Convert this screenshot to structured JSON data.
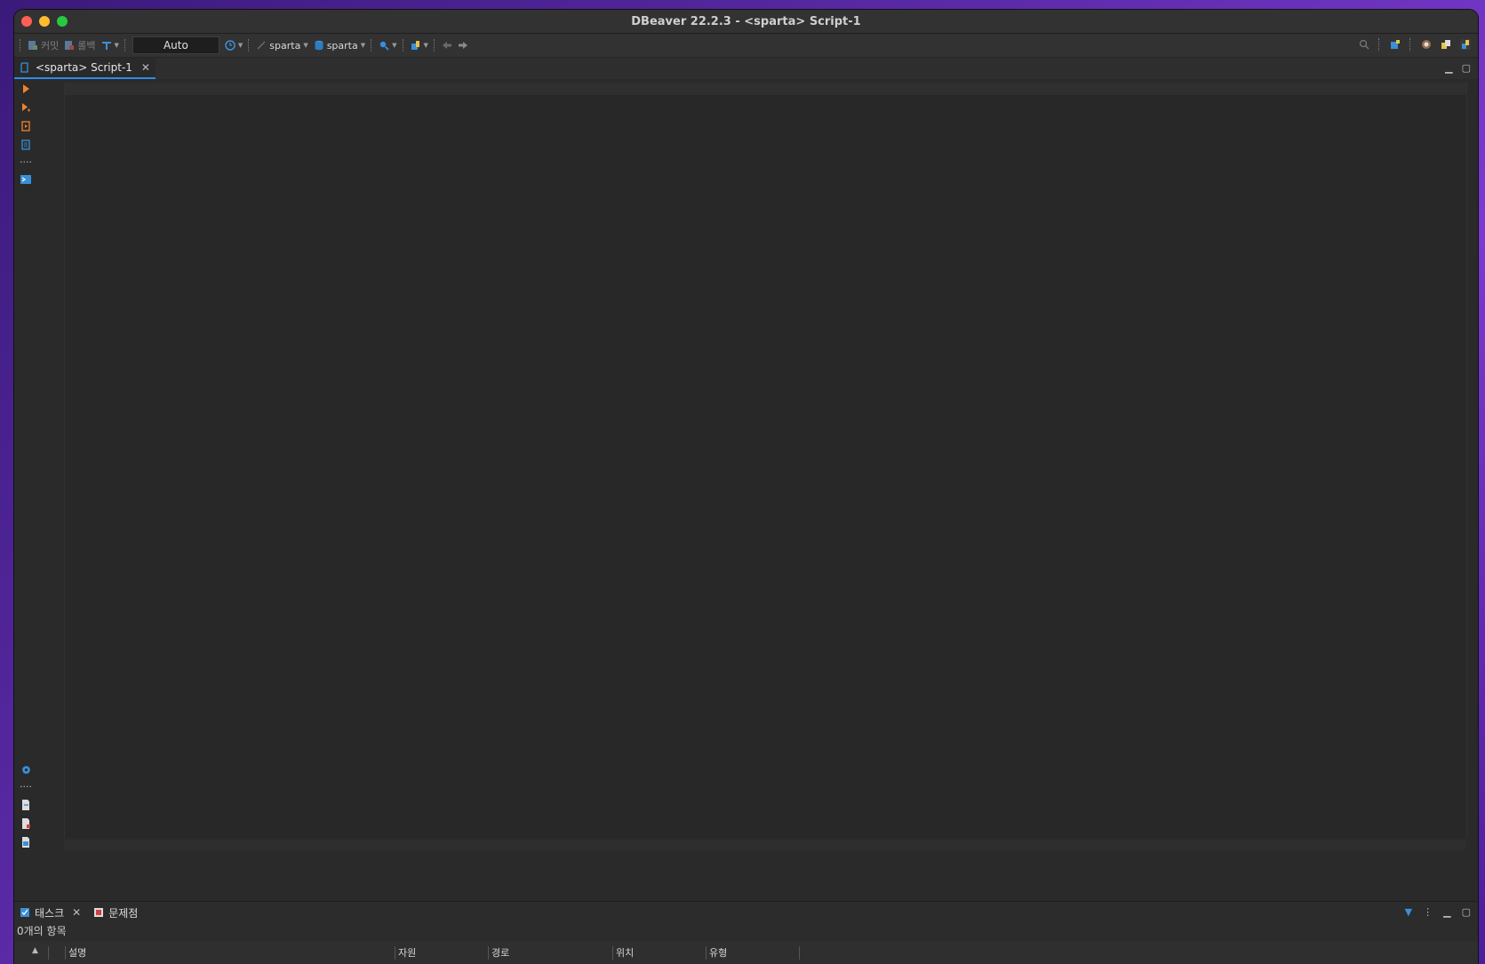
{
  "window": {
    "title": "DBeaver 22.2.3 - <sparta> Script-1"
  },
  "toolbar": {
    "commit_label": "커밋",
    "rollback_label": "롤백",
    "tx_mode": "Auto",
    "datasource_label": "sparta",
    "schema_label": "sparta"
  },
  "editor_tab": {
    "label": "<sparta> Script-1"
  },
  "bottom_panel": {
    "tabs": [
      {
        "label": "태스크"
      },
      {
        "label": "문제점"
      }
    ],
    "item_count": "0개의 항목",
    "columns": [
      "설명",
      "자원",
      "경로",
      "위치",
      "유형"
    ]
  },
  "colors": {
    "accent": "#2e8ce6",
    "run_orange": "#f0842b",
    "background": "#2a2a2a"
  }
}
